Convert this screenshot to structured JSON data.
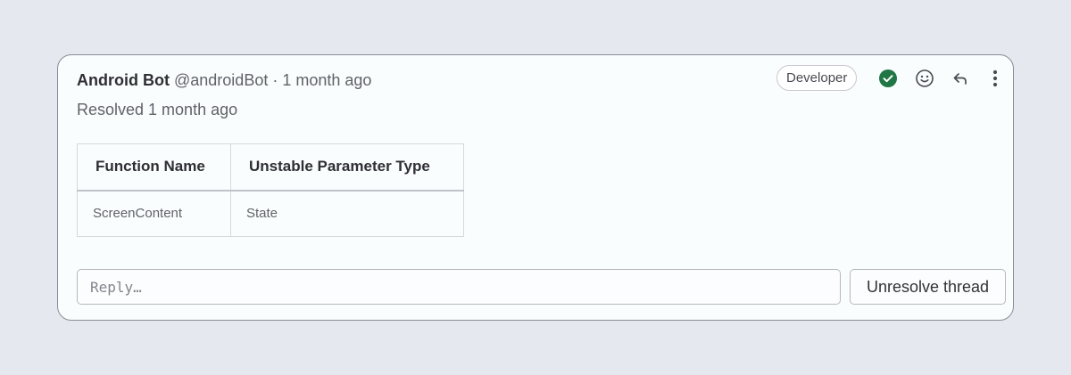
{
  "note": {
    "author": "Android Bot",
    "handle": "@androidBot",
    "separator": "·",
    "time": "1 month ago",
    "resolved_text": "Resolved 1 month ago",
    "role_badge": "Developer"
  },
  "icons": {
    "resolved": "check-circle-icon",
    "emoji": "smiley-icon",
    "reply": "reply-arrow-icon",
    "more": "vertical-ellipsis-icon"
  },
  "colors": {
    "resolved_green": "#217645"
  },
  "table": {
    "headers": [
      "Function Name",
      "Unstable Parameter Type"
    ],
    "rows": [
      [
        "ScreenContent",
        "State"
      ]
    ]
  },
  "reply": {
    "placeholder": "Reply…",
    "unresolve_label": "Unresolve thread"
  }
}
